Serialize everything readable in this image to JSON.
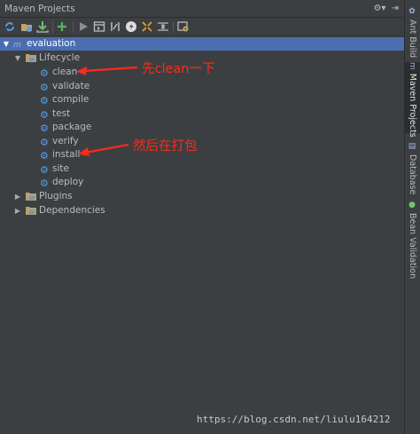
{
  "window": {
    "title": "Maven Projects",
    "tools_icons": [
      "gear-icon",
      "pin-icon"
    ]
  },
  "toolbar": {
    "buttons": [
      {
        "icon": "reimport-icon"
      },
      {
        "icon": "generate-sources-icon"
      },
      {
        "icon": "download-icon"
      },
      {
        "icon": "add-icon"
      },
      {
        "icon": "run-icon"
      },
      {
        "icon": "run-config-icon"
      },
      {
        "icon": "toggle-offline-icon"
      },
      {
        "icon": "skip-tests-icon"
      },
      {
        "icon": "collapse-all-icon"
      },
      {
        "icon": "expand-all-icon"
      },
      {
        "icon": "settings-icon"
      }
    ]
  },
  "tree": {
    "root": {
      "label": "evaluation",
      "expanded": true
    },
    "lifecycle": {
      "label": "Lifecycle",
      "expanded": true,
      "items": [
        "clean",
        "validate",
        "compile",
        "test",
        "package",
        "verify",
        "install",
        "site",
        "deploy"
      ]
    },
    "plugins": {
      "label": "Plugins",
      "expanded": false
    },
    "dependencies": {
      "label": "Dependencies",
      "expanded": false
    }
  },
  "sidebar": {
    "tabs": [
      {
        "label": "Ant Build",
        "active": false
      },
      {
        "label": "Maven Projects",
        "active": true
      },
      {
        "label": "Database",
        "active": false
      },
      {
        "label": "Bean Validation",
        "active": false
      }
    ]
  },
  "annotations": {
    "note1": "先clean一下",
    "note2": "然后在打包"
  },
  "watermark": "https://blog.csdn.net/liulu164212",
  "colors": {
    "background": "#3c3f41",
    "selection": "#4b6eaf",
    "annotation": "#ff2a1a",
    "gear": "#5aa0e6"
  }
}
